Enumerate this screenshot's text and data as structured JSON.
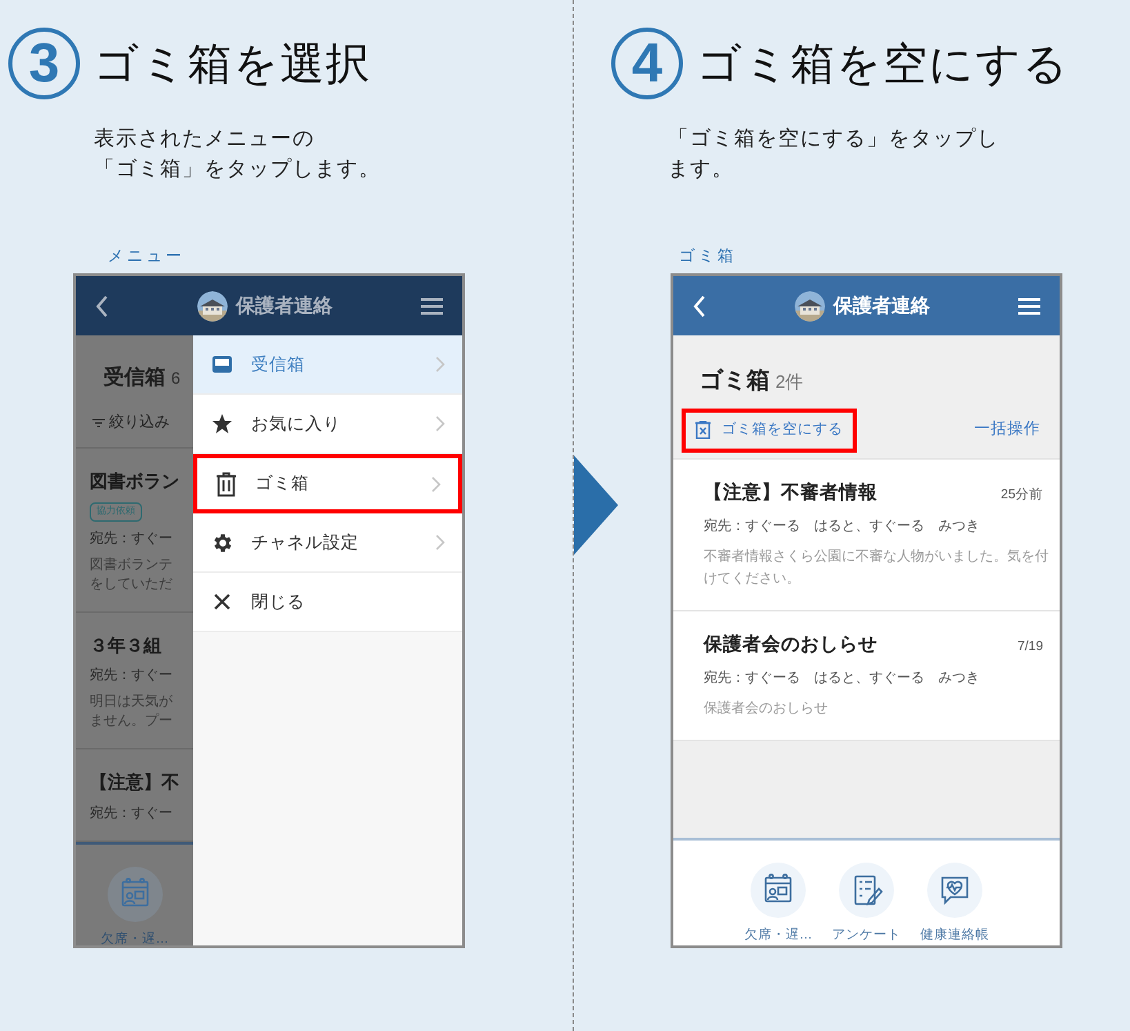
{
  "steps": [
    {
      "number": "3",
      "title": "ゴミ箱を選択",
      "description": [
        "表示されたメニューの",
        "「ゴミ箱」をタップします。"
      ],
      "caption": "メニュー",
      "screen": {
        "kind": "menu",
        "header": {
          "title": "保護者連絡"
        },
        "background": {
          "title": "受信箱",
          "count": "6",
          "filter": "絞り込み",
          "messages": [
            {
              "title": "図書ボラン",
              "tag": "協力依頼",
              "to": "宛先：すぐー",
              "body": [
                "図書ボランテ",
                "をしていただ"
              ]
            },
            {
              "title": "３年３組",
              "to": "宛先：すぐー",
              "body": [
                "明日は天気が",
                "ません。プー"
              ]
            },
            {
              "title": "【注意】不",
              "to": "宛先：すぐー"
            }
          ],
          "nav": [
            {
              "label": "欠席・遅…",
              "kind": "calendar"
            }
          ]
        },
        "menu": [
          {
            "label": "受信箱",
            "kind": "inbox",
            "selected": true,
            "highlighted": false,
            "chevron": true
          },
          {
            "label": "お気に入り",
            "kind": "star",
            "selected": false,
            "highlighted": false,
            "chevron": true
          },
          {
            "label": "ゴミ箱",
            "kind": "trash",
            "selected": false,
            "highlighted": true,
            "chevron": true
          },
          {
            "label": "チャネル設定",
            "kind": "gear",
            "selected": false,
            "highlighted": false,
            "chevron": true
          },
          {
            "label": "閉じる",
            "kind": "close",
            "selected": false,
            "highlighted": false,
            "chevron": false
          }
        ]
      }
    },
    {
      "number": "4",
      "title": "ゴミ箱を空にする",
      "description": [
        "「ゴミ箱を空にする」をタップし",
        "ます。"
      ],
      "caption": "ゴミ箱",
      "screen": {
        "kind": "list",
        "header": {
          "title": "保護者連絡"
        },
        "title": "ゴミ箱",
        "count": "2件",
        "empty_button": {
          "label": "ゴミ箱を空にする",
          "highlighted": true
        },
        "bulk_link": "一括操作",
        "messages": [
          {
            "title": "【注意】不審者情報",
            "time": "25分前",
            "to": "宛先：すぐーる　はると、すぐーる　みつき",
            "body": "不審者情報さくら公園に不審な人物がいました。気を付けてください。"
          },
          {
            "title": "保護者会のおしらせ",
            "time": "7/19",
            "to": "宛先：すぐーる　はると、すぐーる　みつき",
            "body": "保護者会のおしらせ"
          }
        ],
        "nav": [
          {
            "label": "欠席・遅…",
            "kind": "calendar"
          },
          {
            "label": "アンケート",
            "kind": "survey"
          },
          {
            "label": "健康連絡帳",
            "kind": "heart-chat"
          }
        ]
      }
    }
  ]
}
